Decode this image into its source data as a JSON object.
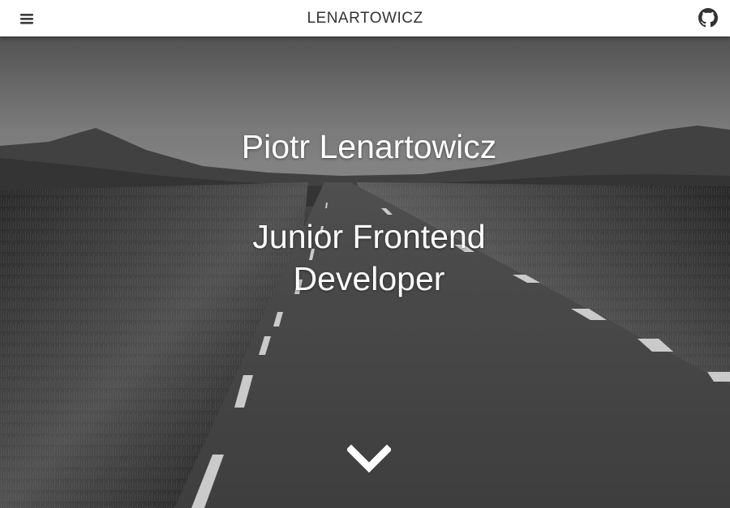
{
  "navbar": {
    "menu_icon": "hamburger-menu-icon",
    "brand": "LENARTOWICZ",
    "github_icon": "github-icon"
  },
  "hero": {
    "name": "Piotr Lenartowicz",
    "role": "Junior Frontend Developer",
    "scroll_icon": "chevron-down-icon",
    "background": "grayscale road through grassland toward hills"
  },
  "colors": {
    "navbar_bg": "#ffffff",
    "brand_text": "#333333",
    "hero_text": "#ffffff"
  }
}
